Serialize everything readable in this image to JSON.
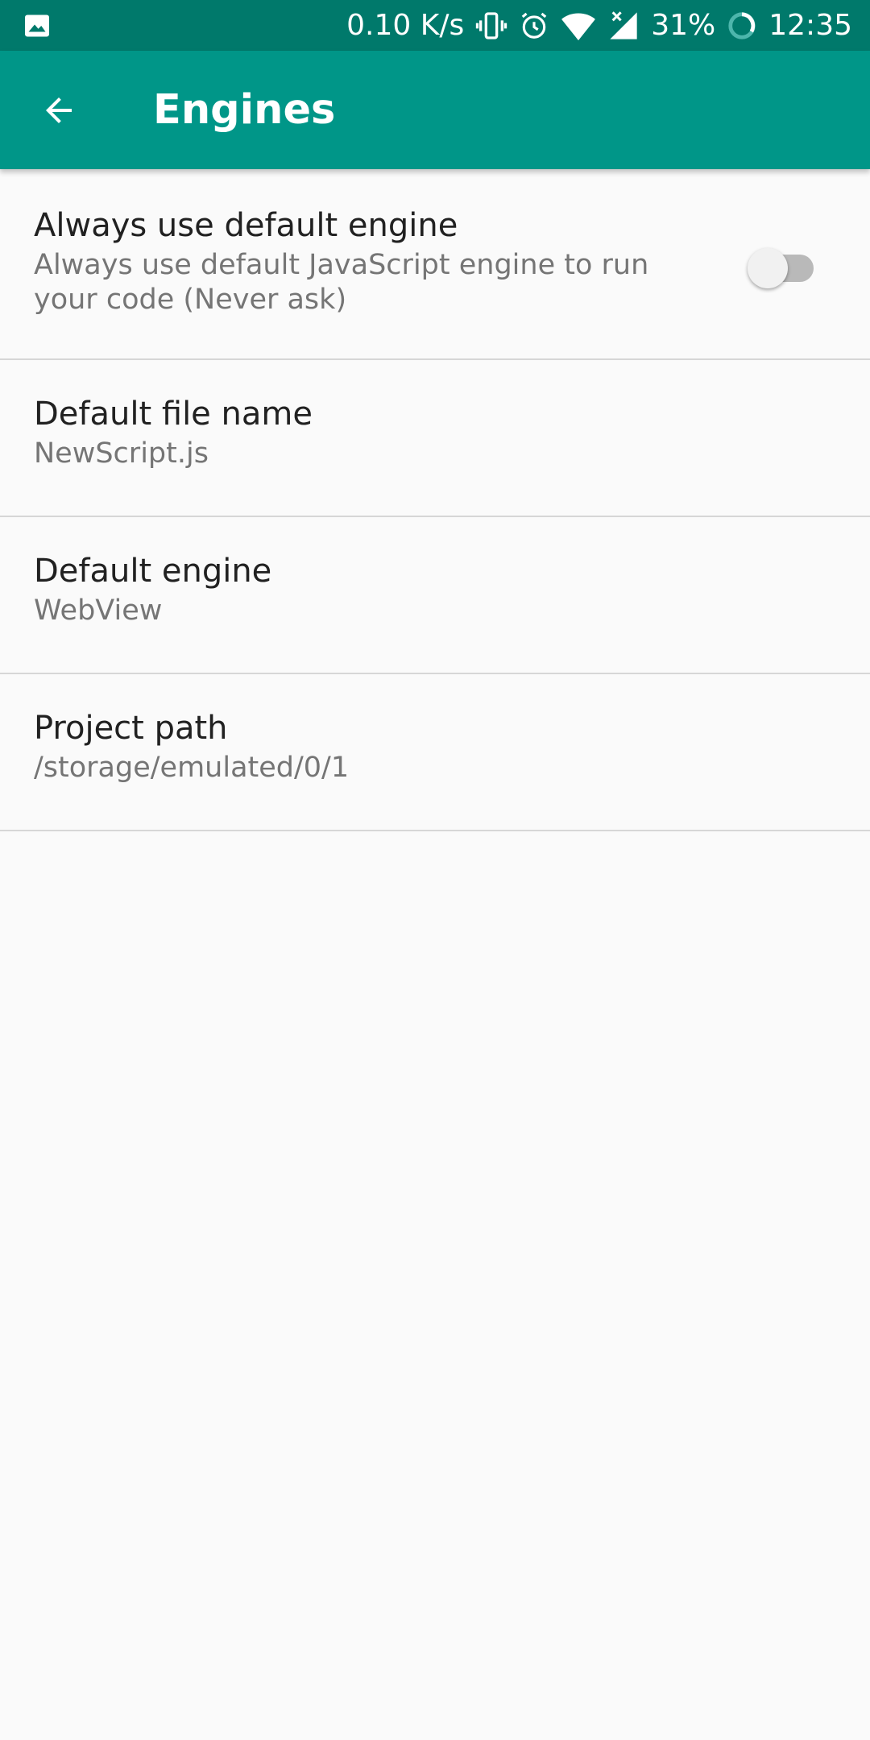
{
  "status_bar": {
    "net_speed": "0.10 K/s",
    "battery": "31%",
    "time": "12:35",
    "icons": [
      "image-icon",
      "vibrate-icon",
      "alarm-icon",
      "wifi-icon",
      "signal-icon",
      "battery-icon"
    ]
  },
  "app_bar": {
    "title": "Engines",
    "back_icon": "arrow-left-icon",
    "color": "#009688",
    "status_color": "#00796b"
  },
  "preferences": [
    {
      "title": "Always use default engine",
      "summary": "Always use default JavaScript engine to run your code (Never ask)",
      "switch_on": false
    },
    {
      "title": "Default file name",
      "summary": "NewScript.js"
    },
    {
      "title": "Default engine",
      "summary": "WebView"
    },
    {
      "title": "Project path",
      "summary": "/storage/emulated/0/1"
    }
  ]
}
